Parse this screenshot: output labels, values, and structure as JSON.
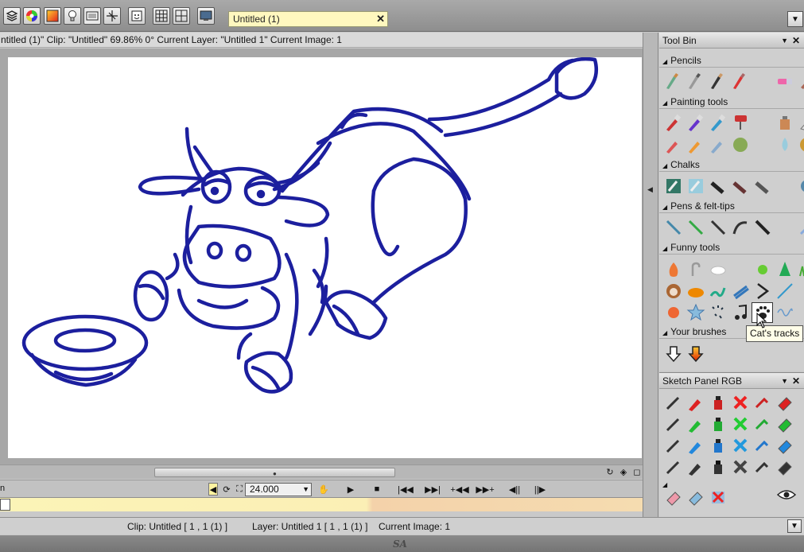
{
  "document_tab": {
    "title": "Untitled (1)"
  },
  "toolbar": {
    "icons": [
      "layers-icon",
      "color-wheel-icon",
      "gradient-icon",
      "lightbulb-icon",
      "keyboard-icon",
      "transform-icon",
      "face-icon",
      "grid-icon",
      "grid-small-icon",
      "monitor-icon"
    ]
  },
  "info_bar": {
    "text": "ntitled (1)\"  Clip: \"Untitled\"   69.86%   0°  Current Layer: \"Untitled 1\"  Current Image: 1"
  },
  "playback": {
    "fps": "24.000",
    "left_label": "n"
  },
  "status_bar": {
    "clip": "Clip: Untitled [ 1 , 1  (1) ]",
    "layer": "Layer: Untitled 1 [ 1 , 1  (1) ]",
    "image": "Current Image: 1"
  },
  "logo": "SA",
  "tool_bin": {
    "title": "Tool Bin",
    "categories": [
      {
        "label": "Pencils"
      },
      {
        "label": "Painting tools"
      },
      {
        "label": "Chalks"
      },
      {
        "label": "Pens & felt-tips"
      },
      {
        "label": "Funny tools"
      },
      {
        "label": "Your brushes"
      }
    ],
    "tooltip": "Cat's tracks"
  },
  "sketch_panel": {
    "title": "Sketch Panel RGB"
  },
  "colors": {
    "stroke": "#1c1f9e",
    "tab_bg": "#fff8bf",
    "tooltip_bg": "#fffde8"
  }
}
